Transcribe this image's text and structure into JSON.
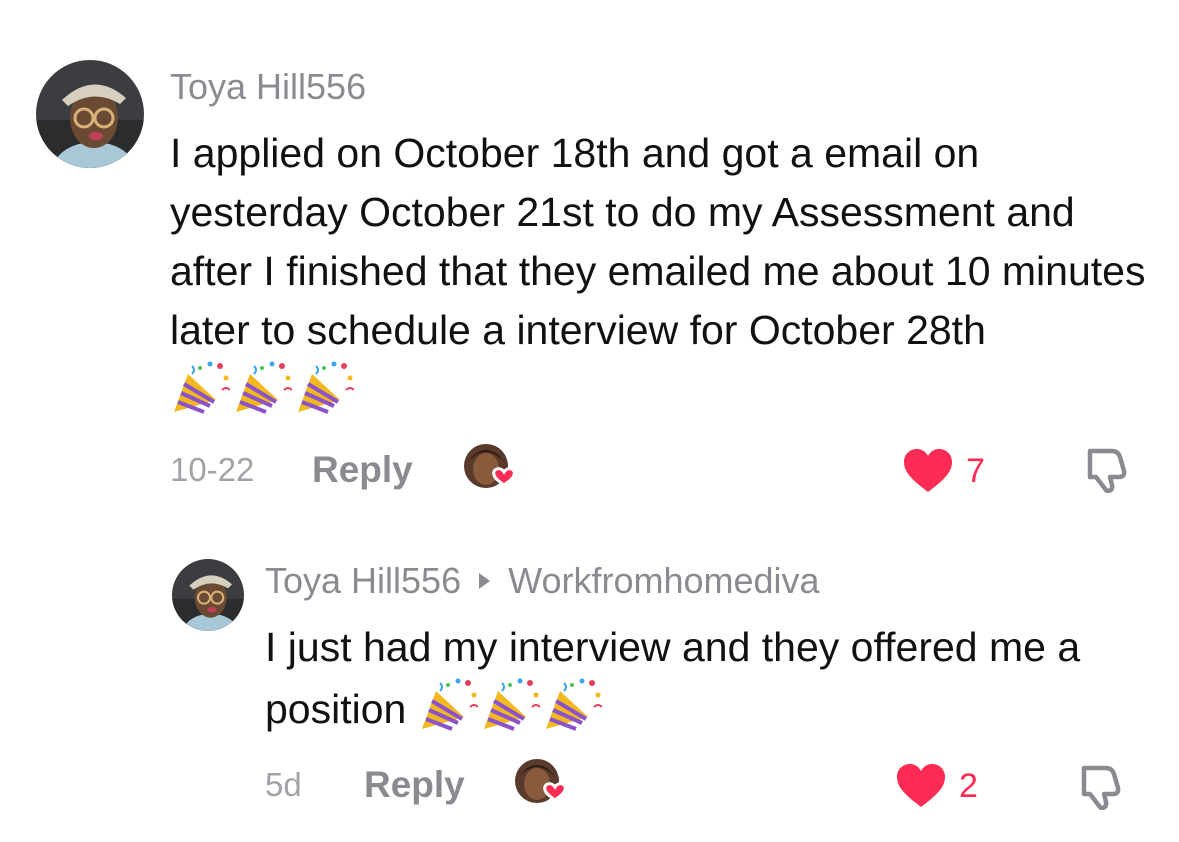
{
  "comments": [
    {
      "username": "Toya Hill556",
      "text": "I applied on October 18th and got a email on yesterday October 21st to do my Assessment and after I finished that they emailed me about 10 minutes later to schedule a interview for October 28th",
      "emoji": [
        "party-popper",
        "party-popper",
        "party-popper"
      ],
      "date": "10-22",
      "reply_label": "Reply",
      "likes": "7"
    },
    {
      "username": "Toya Hill556",
      "reply_to": "Workfromhomediva",
      "text": "I just had my interview and they offered me a position",
      "emoji": [
        "party-popper",
        "party-popper",
        "party-popper"
      ],
      "date": "5d",
      "reply_label": "Reply",
      "likes": "2"
    }
  ],
  "colors": {
    "like": "#fe2c55",
    "muted": "#8a8b91",
    "text": "#111111"
  },
  "icons": [
    "heart-icon",
    "dislike-icon",
    "party-popper-icon",
    "creator-liked-badge"
  ]
}
